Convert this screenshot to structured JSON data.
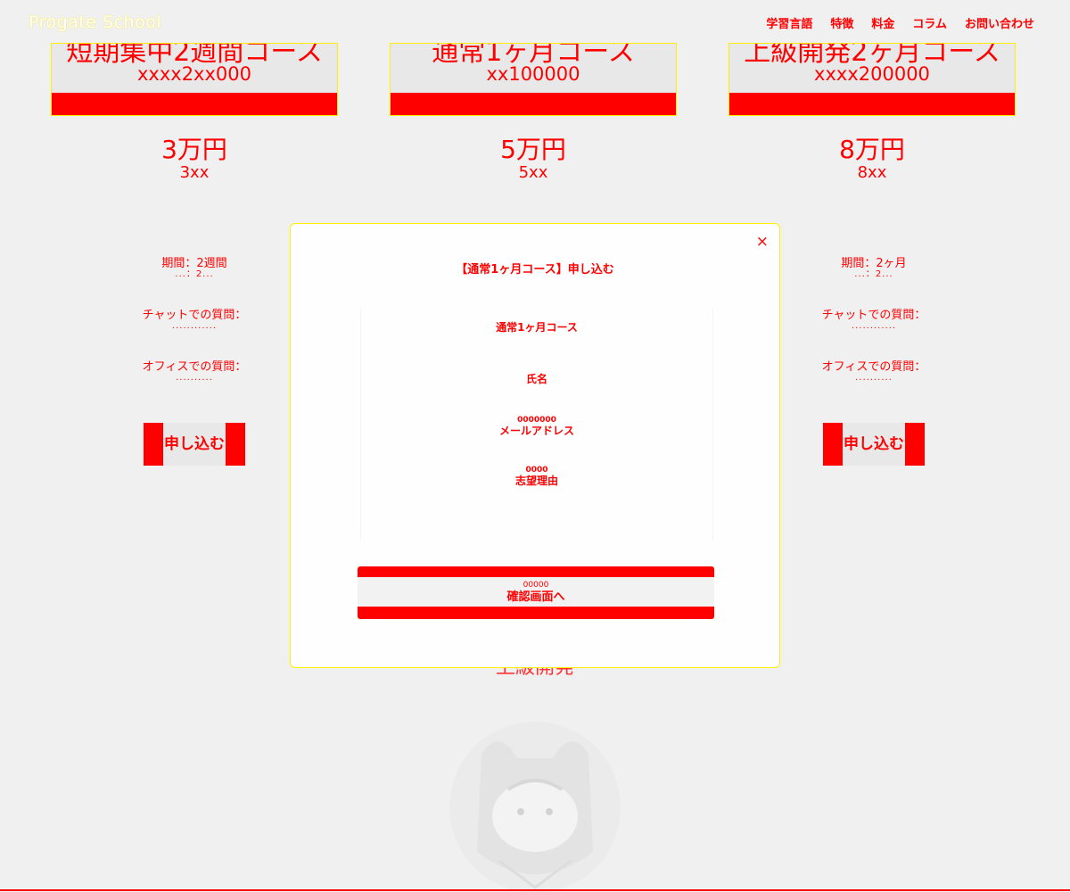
{
  "header": {
    "logo": "Progate School",
    "nav": [
      "学習言語",
      "特徴",
      "料金",
      "コラム",
      "お問い合わせ"
    ]
  },
  "courses": [
    {
      "title": "短期集中2週間コース",
      "subtitle": "xxxx2xx000",
      "price": "3万円",
      "price_sub": "3xx",
      "period": "期間：2週間",
      "period_sub": "...：2...",
      "chat": "チャットでの質問：",
      "chat_sub": "............",
      "office": "オフィスでの質問：",
      "office_sub": "..........",
      "apply": "申し込む"
    },
    {
      "title": "通常1ヶ月コース",
      "subtitle": "xx100000",
      "price": "5万円",
      "price_sub": "5xx"
    },
    {
      "title": "上級開発2ヶ月コース",
      "subtitle": "xxxx200000",
      "price": "8万円",
      "price_sub": "8xx",
      "period": "期間：2ヶ月",
      "period_sub": "...：2...",
      "chat": "チャットでの質問：",
      "chat_sub": "............",
      "office": "オフィスでの質問：",
      "office_sub": "..........",
      "apply": "申し込む"
    }
  ],
  "obscured_heading": "上級開発",
  "modal": {
    "close": "×",
    "title": "【通常1ヶ月コース】申し込む",
    "course_label": "通常1ヶ月コース",
    "name_label": "氏名",
    "email_top": "0000000",
    "email_label": "メールアドレス",
    "reason_top": "0000",
    "reason_label": "志望理由",
    "confirm_top": "00000",
    "confirm_label": "確認画面へ"
  },
  "colors": {
    "accent": "#ff0000",
    "highlight": "#ffee00",
    "background": "#f0f0f0"
  }
}
